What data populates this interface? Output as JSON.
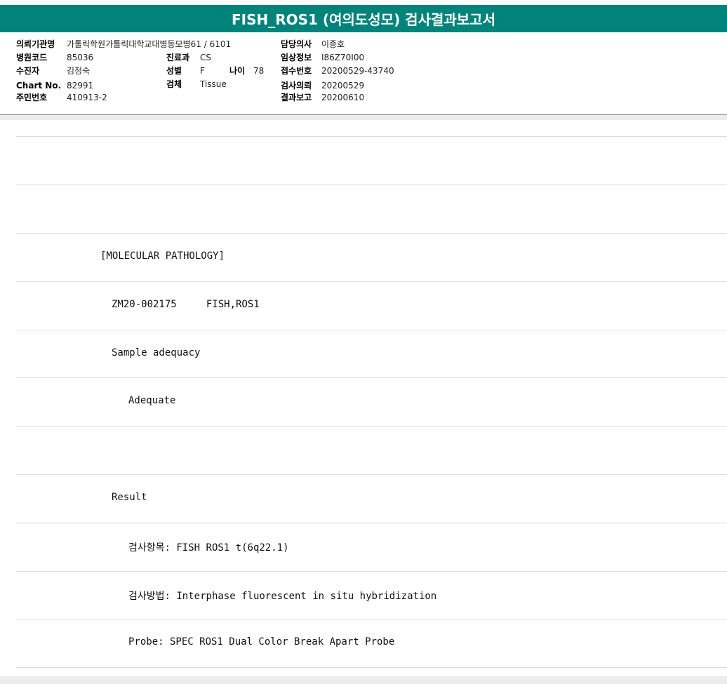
{
  "title": "FISH_ROS1 (여의도성모) 검사결과보고서",
  "header": {
    "institution_label": "의뢰기관명",
    "institution_value": "가톨릭학원가톨릭대학교대병동모병61 / 6101",
    "doctor_label": "담당의사",
    "doctor_value": "이종호",
    "hospital_code_label": "병원코드",
    "hospital_code_value": "85036",
    "department_label": "진료과",
    "department_value": "CS",
    "clinical_info_label": "임상정보",
    "clinical_info_value": "I86Z70I00",
    "patient_label": "수진자",
    "patient_value": "김정숙",
    "sex_label": "성별",
    "sex_value": "F",
    "age_label": "나이",
    "age_value": "78",
    "receipt_label": "접수번호",
    "receipt_value": "20200529-43740",
    "chart_label": "Chart No.",
    "chart_value": "82991",
    "specimen_label": "검체",
    "specimen_value": "Tissue",
    "request_label": "검사의뢰",
    "request_value": "20200529",
    "resident_label": "주민번호",
    "resident_value": "410913-2",
    "report_label": "결과보고",
    "report_value": "20200610"
  },
  "report_lines": [
    "",
    "",
    "[MOLECULAR PATHOLOGY]",
    "ZM20-002175     FISH,ROS1",
    "Sample adequacy",
    "Adequate",
    "",
    "Result",
    "검사항목: FISH ROS1 t(6q22.1)",
    "검사방법: Interphase fluorescent in situ hybridization",
    "Probe: SPEC ROS1 Dual Color Break Apart Probe",
    ""
  ]
}
